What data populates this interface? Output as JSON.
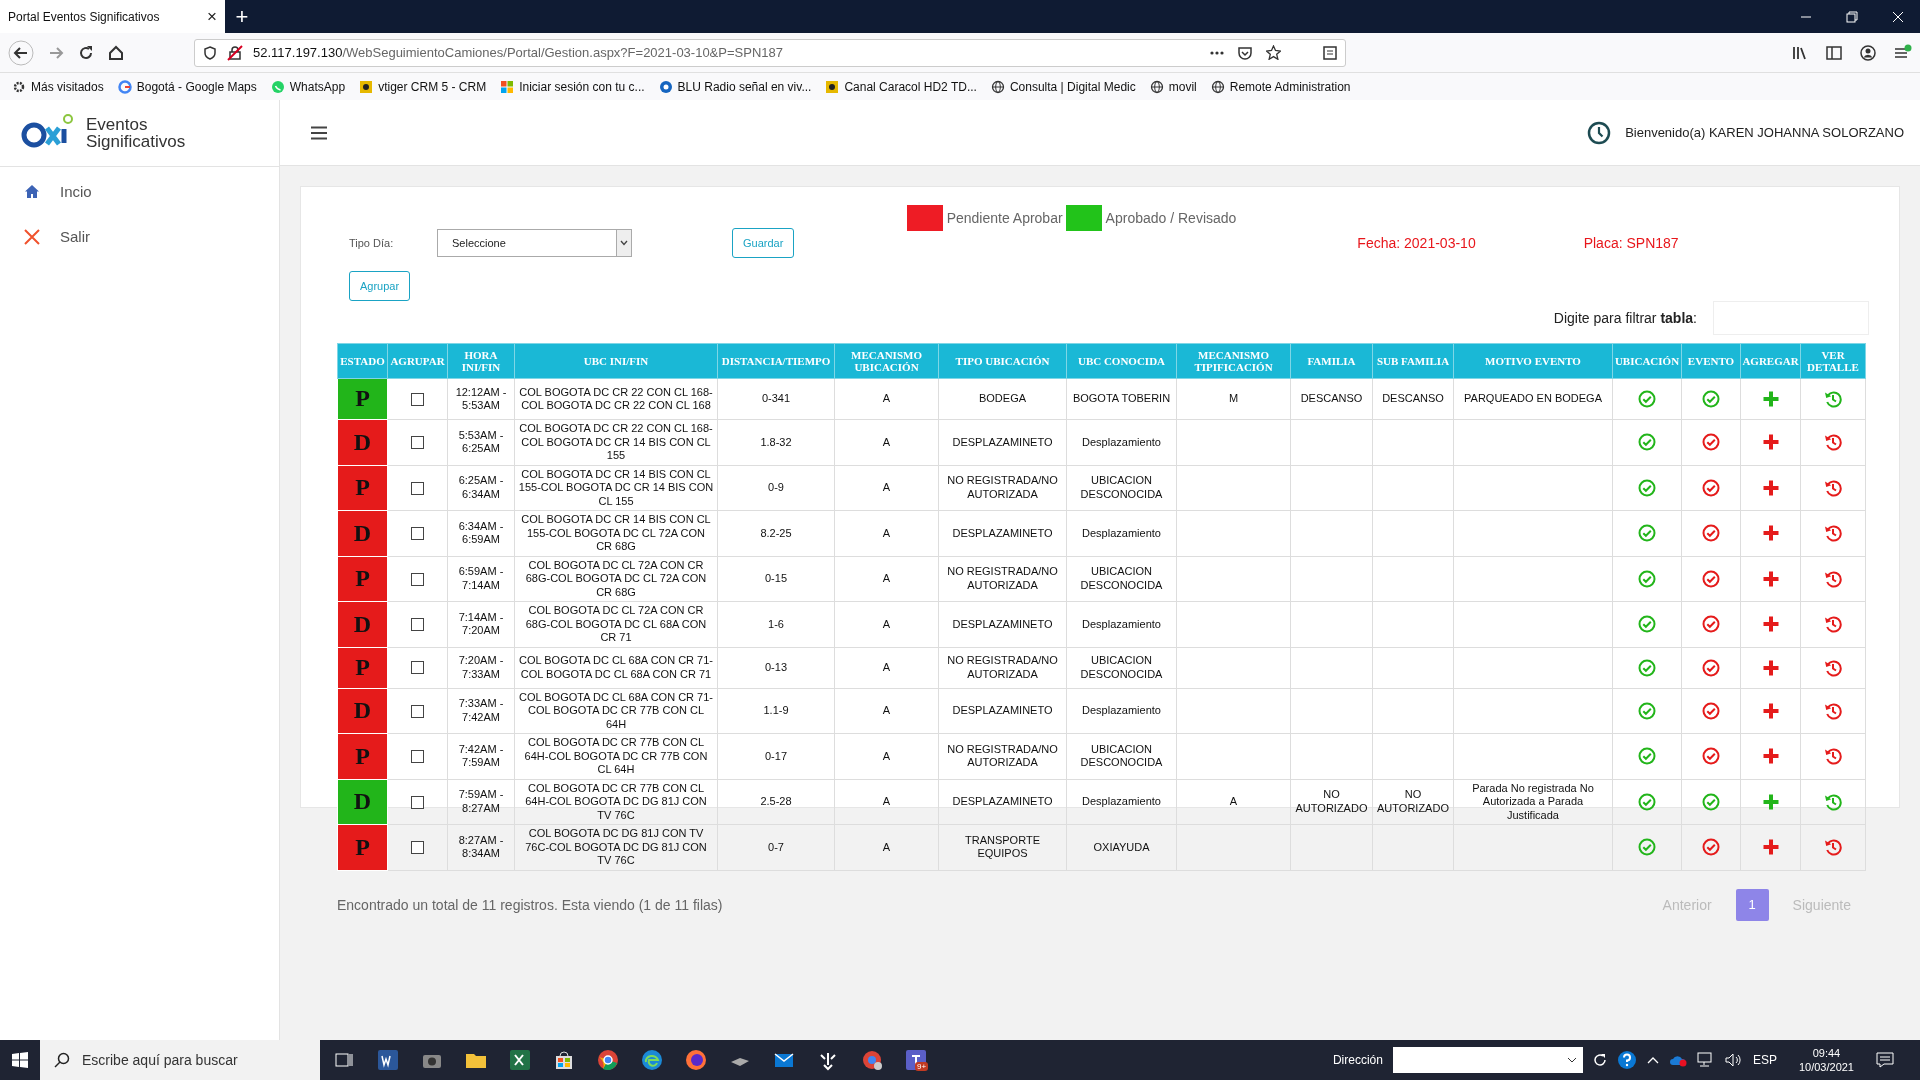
{
  "browser": {
    "tab_title": "Portal Eventos Significativos",
    "tab_close": "×",
    "new_tab": "+",
    "url": {
      "host": "52.117.197.130",
      "path": "/WebSeguimientoCamiones/Portal/Gestion.aspx?F=2021-03-10&P=SPN187"
    },
    "bookmarks": [
      {
        "label": "Más visitados",
        "kind": "gear"
      },
      {
        "label": "Bogotá - Google Maps",
        "kind": "g"
      },
      {
        "label": "WhatsApp",
        "kind": "chat"
      },
      {
        "label": "vtiger CRM 5 - CRM",
        "kind": "square"
      },
      {
        "label": "Iniciar sesión con tu c...",
        "kind": "tiles"
      },
      {
        "label": "BLU Radio señal en viv...",
        "kind": "dot"
      },
      {
        "label": "Canal Caracol HD2 TD...",
        "kind": "square"
      },
      {
        "label": "Consulta | Digital Medic",
        "kind": "globe"
      },
      {
        "label": "movil",
        "kind": "globe"
      },
      {
        "label": "Remote Administration",
        "kind": "globe"
      }
    ]
  },
  "app": {
    "title": "Eventos Significativos",
    "menu": [
      {
        "label": "Incio",
        "kind": "home"
      },
      {
        "label": "Salir",
        "kind": "exit"
      }
    ],
    "welcome": "Bienvenido(a) KAREN JOHANNA SOLORZANO"
  },
  "legend": [
    {
      "label": "Pendiente Aprobar",
      "color": "#ee1c25"
    },
    {
      "label": "Aprobado / Revisado",
      "color": "#22c31a"
    }
  ],
  "tipo_dia": {
    "label": "Tipo Día:",
    "value": "Seleccione"
  },
  "buttons": {
    "save": "Guardar",
    "group": "Agrupar"
  },
  "fecha": "Fecha: 2021-03-10",
  "placa": "Placa: SPN187",
  "filter": {
    "label": "Digite para filtrar **tabla**:"
  },
  "table": {
    "columns": [
      "ESTADO",
      "AGRUPAR",
      "HORA INI/FIN",
      "UBC INI/FIN",
      "DISTANCIA/TIEMPO",
      "MECANISMO UBICACIÓN",
      "TIPO UBICACIÓN",
      "UBC CONOCIDA",
      "MECANISMO TIPIFICACIÓN",
      "FAMILIA",
      "SUB FAMILIA",
      "MOTIVO EVENTO",
      "UBICACIÓN",
      "EVENTO",
      "AGREGAR",
      "VER DETALLE"
    ],
    "rows": [
      {
        "estado": "P",
        "approved": true,
        "checked": false,
        "hora": "12:12AM - 5:53AM",
        "ubc": "COL BOGOTA DC CR 22 CON CL 168-COL BOGOTA DC CR 22 CON CL 168",
        "distancia": "0-341",
        "mecanismo": "A",
        "tipo_ubicacion": "BODEGA",
        "ubc_conocida": "BOGOTA TOBERIN",
        "mecanismo_tipificacion": "M",
        "familia": "DESCANSO",
        "sub_familia": "DESCANSO",
        "motivo": "PARQUEADO EN BODEGA"
      },
      {
        "estado": "D",
        "approved": false,
        "checked": false,
        "hora": "5:53AM - 6:25AM",
        "ubc": "COL BOGOTA DC CR 22 CON CL 168-COL BOGOTA DC CR 14 BIS CON CL 155",
        "distancia": "1.8-32",
        "mecanismo": "A",
        "tipo_ubicacion": "DESPLAZAMINETO",
        "ubc_conocida": "Desplazamiento"
      },
      {
        "estado": "P",
        "approved": false,
        "checked": false,
        "hora": "6:25AM - 6:34AM",
        "ubc": "COL BOGOTA DC CR 14 BIS CON CL 155-COL BOGOTA DC CR 14 BIS CON CL 155",
        "distancia": "0-9",
        "mecanismo": "A",
        "tipo_ubicacion": "NO REGISTRADA/NO AUTORIZADA",
        "ubc_conocida": "UBICACION DESCONOCIDA"
      },
      {
        "estado": "D",
        "approved": false,
        "checked": false,
        "hora": "6:34AM - 6:59AM",
        "ubc": "COL BOGOTA DC CR 14 BIS CON CL 155-COL BOGOTA DC CL 72A CON CR 68G",
        "distancia": "8.2-25",
        "mecanismo": "A",
        "tipo_ubicacion": "DESPLAZAMINETO",
        "ubc_conocida": "Desplazamiento"
      },
      {
        "estado": "P",
        "approved": false,
        "checked": false,
        "hora": "6:59AM - 7:14AM",
        "ubc": "COL BOGOTA DC CL 72A CON CR 68G-COL BOGOTA DC CL 72A CON CR 68G",
        "distancia": "0-15",
        "mecanismo": "A",
        "tipo_ubicacion": "NO REGISTRADA/NO AUTORIZADA",
        "ubc_conocida": "UBICACION DESCONOCIDA"
      },
      {
        "estado": "D",
        "approved": false,
        "checked": false,
        "hora": "7:14AM - 7:20AM",
        "ubc": "COL BOGOTA DC CL 72A CON CR 68G-COL BOGOTA DC CL 68A CON CR 71",
        "distancia": "1-6",
        "mecanismo": "A",
        "tipo_ubicacion": "DESPLAZAMINETO",
        "ubc_conocida": "Desplazamiento"
      },
      {
        "estado": "P",
        "approved": false,
        "checked": false,
        "hora": "7:20AM - 7:33AM",
        "ubc": "COL BOGOTA DC CL 68A CON CR 71-COL BOGOTA DC CL 68A CON CR 71",
        "distancia": "0-13",
        "mecanismo": "A",
        "tipo_ubicacion": "NO REGISTRADA/NO AUTORIZADA",
        "ubc_conocida": "UBICACION DESCONOCIDA"
      },
      {
        "estado": "D",
        "approved": false,
        "checked": false,
        "hora": "7:33AM - 7:42AM",
        "ubc": "COL BOGOTA DC CL 68A CON CR 71-COL BOGOTA DC CR 77B CON CL 64H",
        "distancia": "1.1-9",
        "mecanismo": "A",
        "tipo_ubicacion": "DESPLAZAMINETO",
        "ubc_conocida": "Desplazamiento"
      },
      {
        "estado": "P",
        "approved": false,
        "checked": false,
        "hora": "7:42AM - 7:59AM",
        "ubc": "COL BOGOTA DC CR 77B CON CL 64H-COL BOGOTA DC CR 77B CON CL 64H",
        "distancia": "0-17",
        "mecanismo": "A",
        "tipo_ubicacion": "NO REGISTRADA/NO AUTORIZADA",
        "ubc_conocida": "UBICACION DESCONOCIDA"
      },
      {
        "estado": "D",
        "approved": true,
        "checked": false,
        "hora": "7:59AM - 8:27AM",
        "ubc": "COL BOGOTA DC CR 77B CON CL 64H-COL BOGOTA DC DG 81J CON TV 76C",
        "distancia": "2.5-28",
        "mecanismo": "A",
        "tipo_ubicacion": "DESPLAZAMINETO",
        "ubc_conocida": "Desplazamiento",
        "mecanismo_tipificacion": "A",
        "familia": "NO AUTORIZADO",
        "sub_familia": "NO AUTORIZADO",
        "motivo": "Parada No registrada No Autorizada a Parada Justificada"
      },
      {
        "estado": "P",
        "approved": false,
        "checked": false,
        "hora": "8:27AM - 8:34AM",
        "ubc": "COL BOGOTA DC DG 81J CON TV 76C-COL BOGOTA DC DG 81J CON TV 76C",
        "distancia": "0-7",
        "mecanismo": "A",
        "tipo_ubicacion": "TRANSPORTE EQUIPOS",
        "ubc_conocida": "OXIAYUDA"
      }
    ]
  },
  "summary": "Encontrado un total de 11 registros. Esta viendo (1 de 11 filas)",
  "pagination": {
    "prev": "Anterior",
    "pages": [
      {
        "label": "1",
        "selected": true
      }
    ],
    "next": "Siguiente"
  },
  "taskbar": {
    "search_placeholder": "Escribe aquí para buscar",
    "address_label": "Dirección",
    "badge": "9+",
    "language": "ESP",
    "time": "09:44",
    "date": "10/03/2021"
  }
}
